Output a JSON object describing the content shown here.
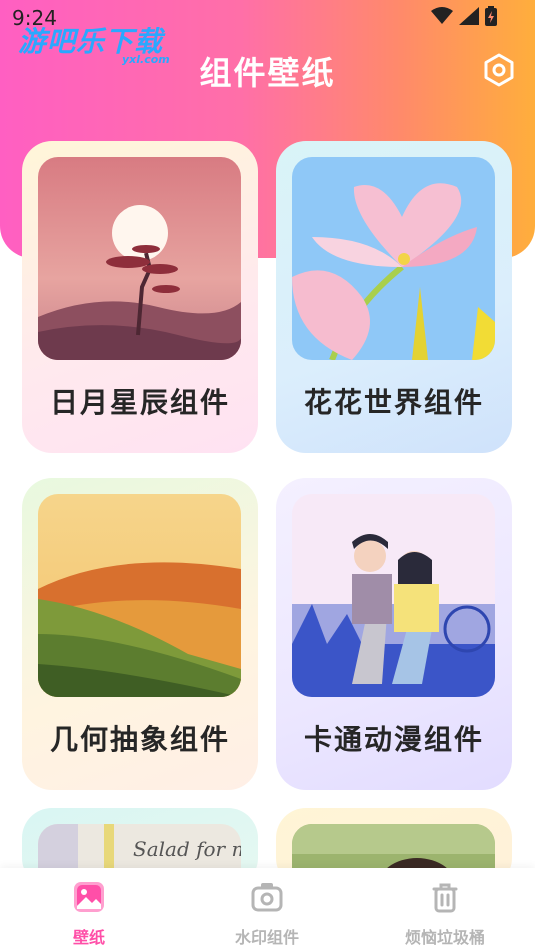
{
  "status_bar": {
    "time": "9:24"
  },
  "watermark": {
    "text": "游吧乐下载",
    "sub": "yxl.com"
  },
  "header": {
    "title": "组件壁纸"
  },
  "cards": [
    {
      "label": "日月星辰组件"
    },
    {
      "label": "花花世界组件"
    },
    {
      "label": "几何抽象组件"
    },
    {
      "label": "卡通动漫组件"
    },
    {
      "label": "",
      "image_text": "Salad for me"
    },
    {
      "label": ""
    }
  ],
  "tabbar": {
    "tabs": [
      {
        "label": "壁纸",
        "active": true
      },
      {
        "label": "水印组件",
        "active": false
      },
      {
        "label": "烦恼垃圾桶",
        "active": false
      }
    ]
  },
  "colors": {
    "accent": "#ff4fa8",
    "header_gradient": [
      "#ff5fc2",
      "#ffae3c"
    ],
    "inactive": "#b5b5b5"
  },
  "icons": [
    "wifi-icon",
    "signal-icon",
    "battery-icon",
    "settings-icon",
    "image-icon",
    "camera-icon",
    "trash-icon"
  ]
}
